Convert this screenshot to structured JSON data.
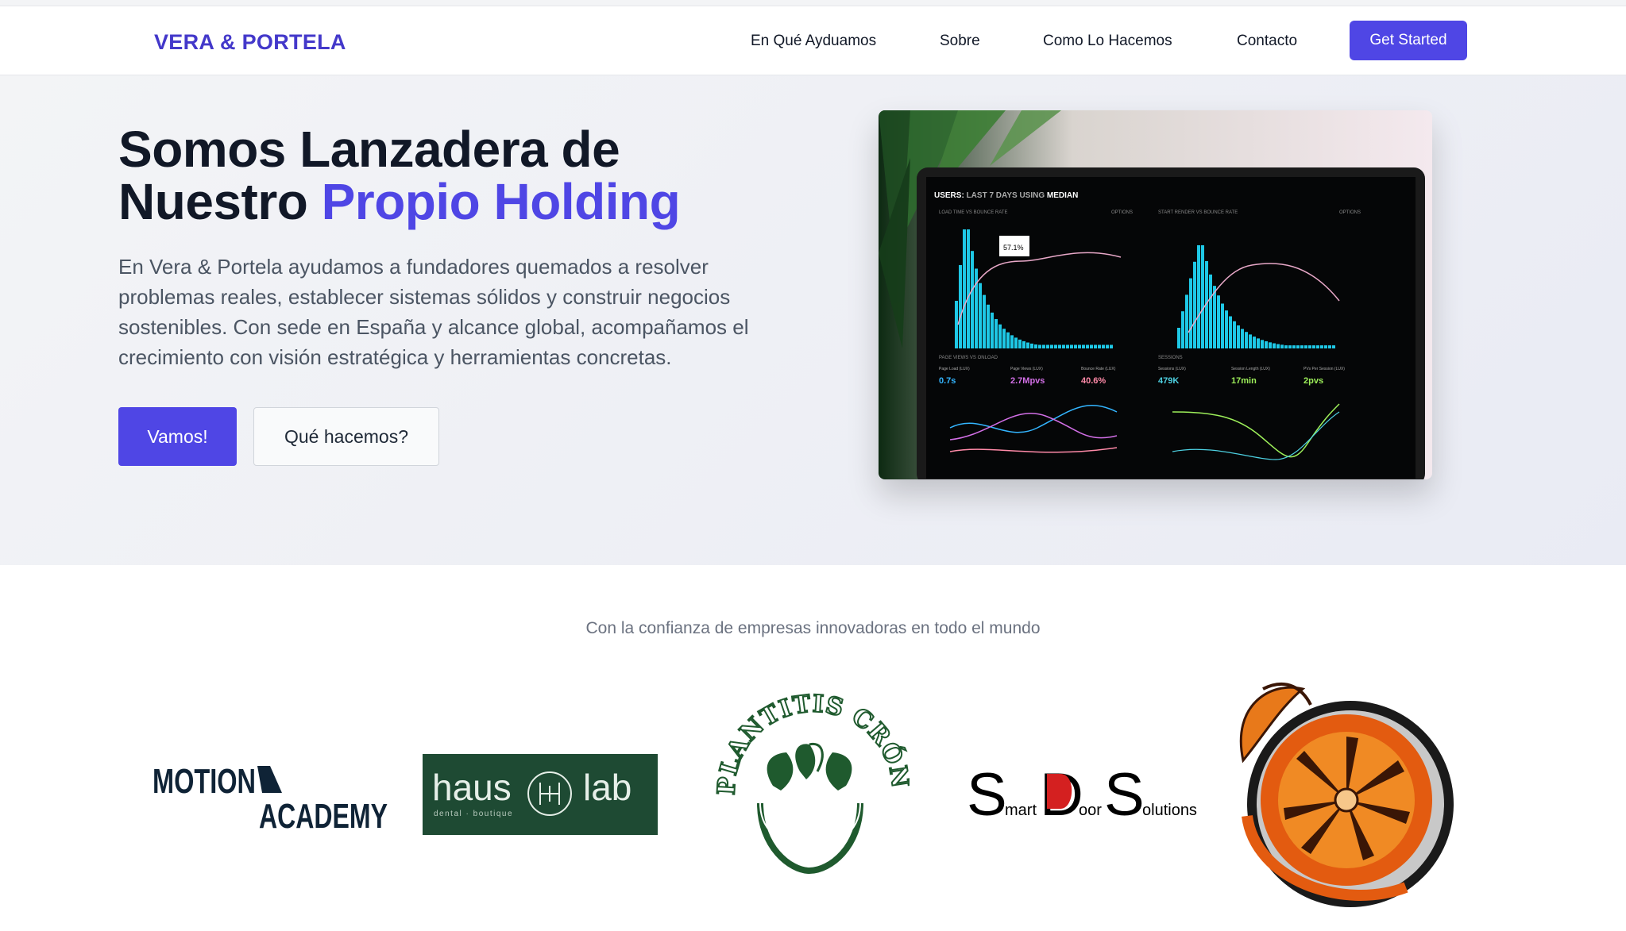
{
  "header": {
    "brand": "VERA & PORTELA",
    "nav": [
      "En Qué Ayduamos",
      "Sobre",
      "Como Lo Hacemos",
      "Contacto"
    ],
    "cta": "Get Started"
  },
  "hero": {
    "title_line1": "Somos Lanzadera de",
    "title_line2_plain": "Nuestro ",
    "title_line2_accent": "Propio Holding",
    "description": "En Vera & Portela ayudamos a fundadores quemados a resolver problemas reales, establecer sistemas sólidos y construir negocios sostenibles. Con sede en España y alcance global, acompañamos el crecimiento con visión estratégica y herramientas concretas.",
    "primary_button": "Vamos!",
    "secondary_button": "Qué hacemos?",
    "dashboard": {
      "heading_prefix": "USERS:",
      "heading_range": "LAST 7 DAYS",
      "heading_using": "USING",
      "heading_stat": "MEDIAN",
      "panel1_title": "LOAD TIME VS BOUNCE RATE",
      "panel2_title": "START RENDER VS BOUNCE RATE",
      "options": "OPTIONS",
      "tooltip": "57.1%",
      "metrics": [
        {
          "label": "Page Load (LUX)",
          "value": "0.7s"
        },
        {
          "label": "Page Views (LUX)",
          "value": "2.7Mpvs"
        },
        {
          "label": "Bounce Rate (LUX)",
          "value": "40.6%"
        },
        {
          "label": "Sessions (LUX)",
          "value": "479K"
        },
        {
          "label": "Session Length (LUX)",
          "value": "17min"
        },
        {
          "label": "PVs Per Session (LUX)",
          "value": "2pvs"
        }
      ],
      "panel3_title": "PAGE VIEWS VS ONLOAD",
      "panel4_title": "SESSIONS"
    }
  },
  "trust": {
    "heading": "Con la confianza de empresas innovadoras en todo el mundo",
    "logos": {
      "motion": {
        "line1": "MOTION",
        "line2": "ACADEMY"
      },
      "haus": {
        "word1": "haus",
        "word2": "lab",
        "sub": "dental · boutique"
      },
      "plantitis": {
        "text": "PLANTITIS CRÓNICA"
      },
      "sds": {
        "s1": "S",
        "r1": "mart",
        "s2": "D",
        "r2": "oor",
        "s3": "S",
        "r3": "olutions"
      }
    }
  },
  "colors": {
    "accent": "#4f46e5",
    "brand": "#4338ca",
    "haus_bg": "#1e4a33",
    "plantitis": "#1f5a2e"
  }
}
